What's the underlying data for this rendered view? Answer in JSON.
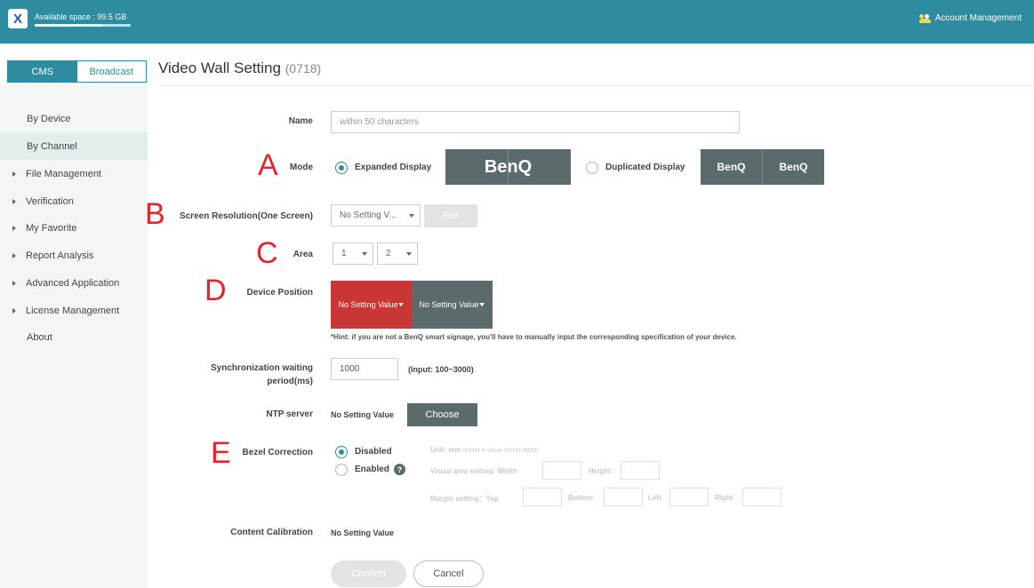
{
  "topbar": {
    "logo_letter": "X",
    "available_space": "Available space : 99.5 GB",
    "space_used_fraction": 0.7,
    "top_caption": "",
    "account_label": "Account Management"
  },
  "tabs": {
    "cms": "CMS",
    "broadcast": "Broadcast"
  },
  "page": {
    "title": "Video Wall Setting",
    "code": "(0718)"
  },
  "sidebar": {
    "items": [
      {
        "label": "By Device"
      },
      {
        "label": "By Channel"
      },
      {
        "label": "File Management"
      },
      {
        "label": "Verification"
      },
      {
        "label": "My Favorite"
      },
      {
        "label": "Report Analysis"
      },
      {
        "label": "Advanced Application"
      },
      {
        "label": "License Management"
      },
      {
        "label": "About"
      }
    ]
  },
  "markers": {
    "a": "A",
    "b": "B",
    "c": "C",
    "d": "D",
    "e": "E"
  },
  "form": {
    "name_label": "Name",
    "name_placeholder": "within 50 characters",
    "mode_label": "Mode",
    "mode_expanded": "Expanded Display",
    "mode_duplicated": "Duplicated Display",
    "benq": "BenQ",
    "resolution_label": "Screen Resolution(One Screen)",
    "resolution_value": "No Setting V...",
    "edit_button": "Edit",
    "area_label": "Area",
    "area_rows": "1",
    "area_cols": "2",
    "device_position_label": "Device Position",
    "position_cell_1": "No Setting Value",
    "position_cell_2": "No Setting Value",
    "hint": "*Hint: if you are not a BenQ smart signage, you'll have to manually input the corresponding specification of your device.",
    "sync_label_1": "Synchronization waiting",
    "sync_label_2": "period(ms)",
    "sync_value": "1000",
    "sync_range": "(Input: 100~3000)",
    "ntp_label": "NTP server",
    "ntp_value": "No Setting Value",
    "choose_button": "Choose",
    "bezel_label": "Bezel Correction",
    "bezel_disabled": "Disabled",
    "bezel_enabled": "Enabled",
    "unit_label": "Unit: mm",
    "unit_hint": "(Enter a value of 0 to 9999)",
    "visual_area": "Visual area setting: Width",
    "height": "Height",
    "margin_setting": "Margin setting：Top",
    "bottom": "Bottom",
    "left": "Left",
    "right": "Right",
    "calibration_label": "Content Calibration",
    "calibration_value": "No Setting Value",
    "confirm": "Confirm",
    "cancel": "Cancel"
  },
  "colors": {
    "accent": "#2f8b9f",
    "marker": "#e8242b",
    "position_red": "#c93636",
    "position_gray": "#5b6b6b"
  }
}
